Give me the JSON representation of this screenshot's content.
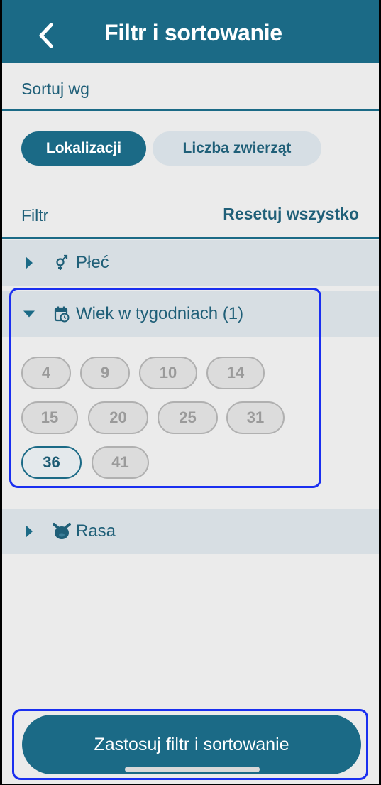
{
  "header": {
    "title": "Filtr i sortowanie",
    "back_icon": "chevron-left-icon"
  },
  "sort": {
    "label": "Sortuj wg",
    "options": [
      {
        "label": "Lokalizacji",
        "active": true
      },
      {
        "label": "Liczba zwierząt",
        "active": false
      }
    ]
  },
  "filter": {
    "label": "Filtr",
    "reset_label": "Resetuj wszystko",
    "groups": [
      {
        "label": "Płeć",
        "icon": "gender-icon",
        "expanded": false
      },
      {
        "label": "Wiek w tygodniach (1)",
        "icon": "calendar-clock-icon",
        "expanded": true,
        "chips": [
          {
            "label": "4",
            "selected": false
          },
          {
            "label": "9",
            "selected": false
          },
          {
            "label": "10",
            "selected": false
          },
          {
            "label": "14",
            "selected": false
          },
          {
            "label": "15",
            "selected": false
          },
          {
            "label": "20",
            "selected": false
          },
          {
            "label": "25",
            "selected": false
          },
          {
            "label": "31",
            "selected": false
          },
          {
            "label": "36",
            "selected": true
          },
          {
            "label": "41",
            "selected": false
          }
        ]
      },
      {
        "label": "Rasa",
        "icon": "pig-icon",
        "expanded": false
      }
    ]
  },
  "apply_button": {
    "label": "Zastosuj filtr i sortowanie"
  },
  "colors": {
    "primary": "#1b6a86",
    "background": "#ebebeb",
    "row": "#d7dee3",
    "highlight": "#1a2ff0"
  }
}
